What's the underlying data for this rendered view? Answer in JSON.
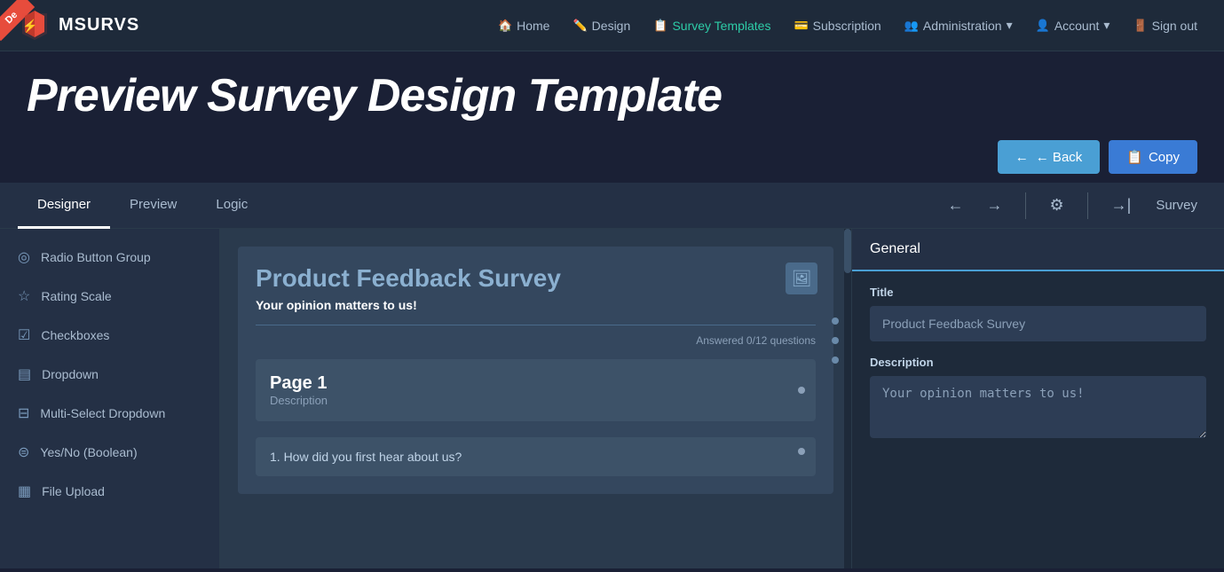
{
  "nav": {
    "logo_text": "MSURVS",
    "links": [
      {
        "label": "Home",
        "icon": "🏠",
        "active": false
      },
      {
        "label": "Design",
        "icon": "✏️",
        "active": false
      },
      {
        "label": "Survey Templates",
        "icon": "📋",
        "active": true
      },
      {
        "label": "Subscription",
        "icon": "💳",
        "active": false
      },
      {
        "label": "Administration",
        "icon": "👥",
        "active": false,
        "dropdown": true
      },
      {
        "label": "Account",
        "icon": "👤",
        "active": false,
        "dropdown": true
      },
      {
        "label": "Sign out",
        "icon": "🚪",
        "active": false
      }
    ]
  },
  "page": {
    "title": "Preview Survey Design Template"
  },
  "header_actions": {
    "back_label": "← Back",
    "copy_label": "Copy"
  },
  "designer": {
    "tabs": [
      {
        "label": "Designer",
        "active": true
      },
      {
        "label": "Preview",
        "active": false
      },
      {
        "label": "Logic",
        "active": false
      }
    ],
    "survey_label": "Survey",
    "right_arrow": "→|"
  },
  "sidebar": {
    "items": [
      {
        "label": "Radio Button Group",
        "icon": "◎"
      },
      {
        "label": "Rating Scale",
        "icon": "☆"
      },
      {
        "label": "Checkboxes",
        "icon": "☑"
      },
      {
        "label": "Dropdown",
        "icon": "▤"
      },
      {
        "label": "Multi-Select Dropdown",
        "icon": "⊟"
      },
      {
        "label": "Yes/No (Boolean)",
        "icon": "⊜"
      },
      {
        "label": "File Upload",
        "icon": "▦"
      }
    ]
  },
  "canvas": {
    "survey_title": "Product Feedback Survey",
    "survey_subtitle": "Your opinion matters to us!",
    "answered_text": "Answered 0/12 questions",
    "page1_title": "Page 1",
    "page1_desc": "Description",
    "question1": "1. How did you first hear about us?"
  },
  "right_panel": {
    "general_label": "General",
    "title_label": "Title",
    "title_value": "Product Feedback Survey",
    "description_label": "Description",
    "description_value": "Your opinion matters to us!"
  }
}
